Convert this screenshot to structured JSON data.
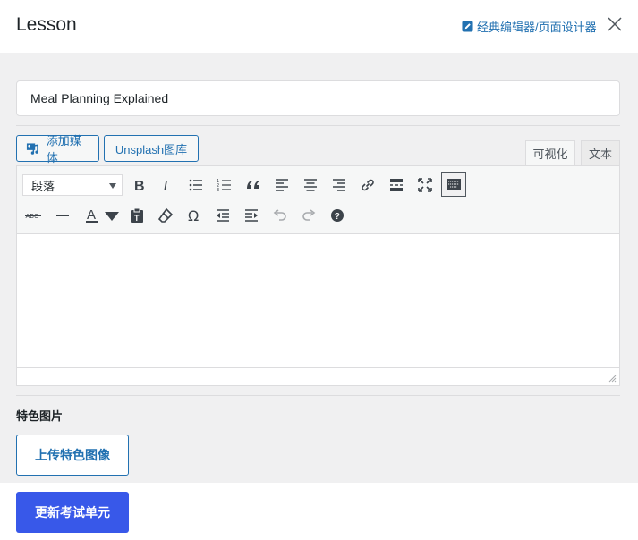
{
  "header": {
    "title": "Lesson",
    "classic_editor_link": "经典编辑器/页面设计器"
  },
  "lesson_title_input": {
    "value": "Meal Planning Explained"
  },
  "media_buttons": {
    "add_media": "添加媒体",
    "unsplash": "Unsplash图库"
  },
  "editor_tabs": {
    "visual": "可视化",
    "text": "文本",
    "active": "visual"
  },
  "toolbar": {
    "format_select": "段落",
    "row1_icons": [
      "bold-icon",
      "italic-icon",
      "bulleted-list-icon",
      "numbered-list-icon",
      "blockquote-icon",
      "align-left-icon",
      "align-center-icon",
      "align-right-icon",
      "link-icon",
      "read-more-icon",
      "fullscreen-icon",
      "toolbar-toggle-icon"
    ],
    "row2_icons": [
      "strikethrough-icon",
      "horizontal-line-icon",
      "text-color-icon",
      "paste-text-icon",
      "clear-formatting-icon",
      "special-character-icon",
      "outdent-icon",
      "indent-icon",
      "undo-icon",
      "redo-icon",
      "help-icon"
    ]
  },
  "featured_image": {
    "label": "特色图片",
    "upload_button": "上传特色图像"
  },
  "footer": {
    "update_button": "更新考试单元"
  },
  "colors": {
    "accent": "#2271b1",
    "primary": "#3858e9",
    "background": "#f0f0f1"
  }
}
